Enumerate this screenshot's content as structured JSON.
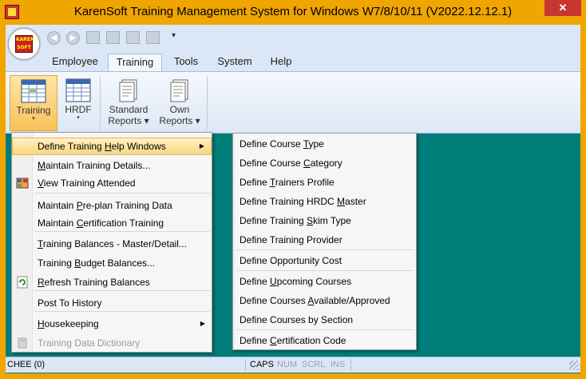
{
  "window": {
    "title": "KarenSoft Training Management System for Windows W7/8/10/11 (V2022.12.12.1)",
    "close_glyph": "✕"
  },
  "orb": {
    "logo_line1": "KAREN",
    "logo_line2": "SOFT"
  },
  "qat": {
    "dropdown_glyph": "▾"
  },
  "tabs": [
    {
      "label": "Employee"
    },
    {
      "label": "Training"
    },
    {
      "label": "Tools"
    },
    {
      "label": "System"
    },
    {
      "label": "Help"
    }
  ],
  "active_tab": "Training",
  "ribbon": {
    "buttons": [
      {
        "label": "Training",
        "label2": "",
        "arrow": "▾"
      },
      {
        "label": "HRDF",
        "label2": "",
        "arrow": "▾"
      },
      {
        "label": "Standard",
        "label2": "Reports ▾",
        "arrow": ""
      },
      {
        "label": "Own",
        "label2": "Reports ▾",
        "arrow": ""
      }
    ]
  },
  "menu": {
    "items": [
      {
        "pre": "Define Training ",
        "u": "H",
        "post": "elp Windows",
        "submenu": true,
        "highlighted": true
      },
      {
        "pre": "",
        "u": "M",
        "post": "aintain Training Details...",
        "icon": ""
      },
      {
        "pre": "",
        "u": "V",
        "post": "iew Training Attended",
        "icon": "grid-icon"
      },
      {
        "pre": "Maintain ",
        "u": "P",
        "post": "re-plan Training Data"
      },
      {
        "pre": "Maintain ",
        "u": "C",
        "post": "ertification Training"
      },
      {
        "pre": "",
        "u": "T",
        "post": "raining Balances - Master/Detail..."
      },
      {
        "pre": "Training  ",
        "u": "B",
        "post": "udget Balances..."
      },
      {
        "pre": "",
        "u": "R",
        "post": "efresh Training Balances",
        "icon": "refresh-icon"
      },
      {
        "pre": "Post To History",
        "u": "",
        "post": ""
      },
      {
        "pre": "",
        "u": "H",
        "post": "ousekeeping",
        "submenu": true
      },
      {
        "pre": "Training Data Dictionary",
        "u": "",
        "post": "",
        "disabled": true,
        "icon": "book-icon"
      }
    ],
    "arrow_glyph": "▶"
  },
  "submenu": {
    "items": [
      {
        "pre": "Define Course ",
        "u": "T",
        "post": "ype"
      },
      {
        "pre": "Define Course ",
        "u": "C",
        "post": "ategory"
      },
      {
        "pre": "Define ",
        "u": "T",
        "post": "rainers Profile"
      },
      {
        "pre": "Define Training HRDC ",
        "u": "M",
        "post": "aster"
      },
      {
        "pre": "Define Training ",
        "u": "S",
        "post": "kim Type"
      },
      {
        "pre": "Define Training Provider",
        "u": "",
        "post": ""
      },
      {
        "pre": "Define Opportunity Cost",
        "u": "",
        "post": ""
      },
      {
        "pre": "Define ",
        "u": "U",
        "post": "pcoming Courses"
      },
      {
        "pre": "Define Courses ",
        "u": "A",
        "post": "vailable/Approved"
      },
      {
        "pre": "Define Courses by Section",
        "u": "",
        "post": ""
      },
      {
        "pre": "Define ",
        "u": "C",
        "post": "ertification Code"
      }
    ]
  },
  "status": {
    "user": "CHEE (0)",
    "caps": "CAPS",
    "num": "NUM",
    "scrl": "SCRL",
    "ins": "INS"
  },
  "colors": {
    "frame": "#f0a500",
    "workspace": "#007d79",
    "ribbon": "#dbe7f6",
    "highlight": "#fbd77b"
  }
}
